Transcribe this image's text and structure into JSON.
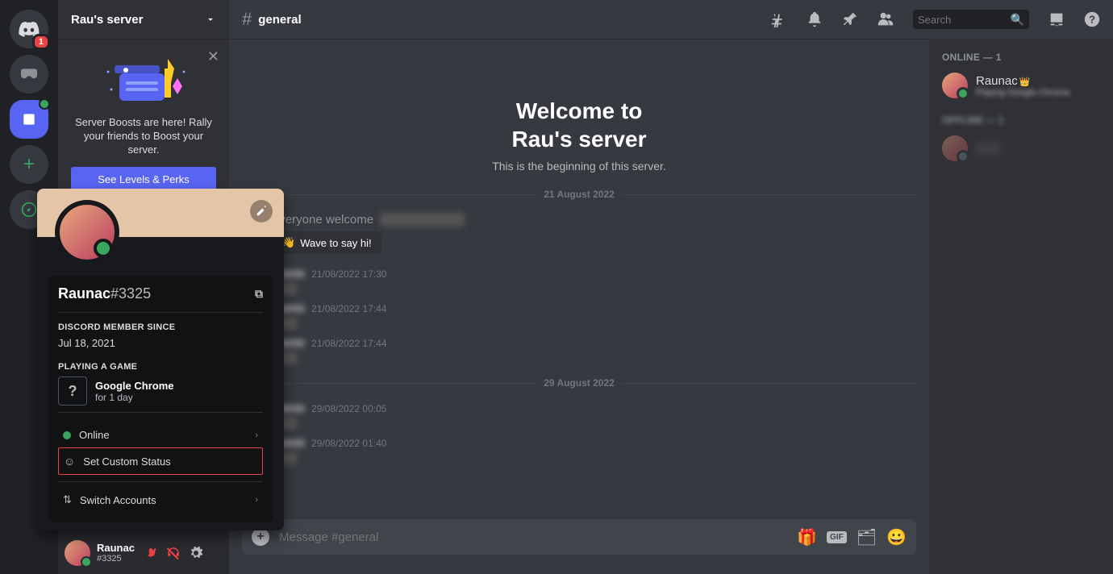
{
  "server_col": {
    "badge": "1"
  },
  "server_header": {
    "name": "Rau's server"
  },
  "boost": {
    "text": "Server Boosts are here! Rally your friends to Boost your server.",
    "button": "See Levels & Perks"
  },
  "user_panel": {
    "name": "Raunac",
    "tag": "#3325"
  },
  "channel_header": {
    "name": "general",
    "search_placeholder": "Search"
  },
  "welcome": {
    "line1": "Welcome to",
    "line2": "Rau's server",
    "sub": "This is the beginning of this server."
  },
  "dividers": {
    "d1": "21 August 2022",
    "d2": "29 August 2022"
  },
  "system": {
    "prefix": "everyone welcome",
    "wave": "Wave to say hi!"
  },
  "messages": [
    {
      "user": "Name",
      "time": "21/08/2022 17:30"
    },
    {
      "user": "Name",
      "time": "21/08/2022 17:44"
    },
    {
      "user": "Name",
      "time": "21/08/2022 17:44"
    },
    {
      "user": "Name",
      "time": "29/08/2022 00:05"
    },
    {
      "user": "Name",
      "time": "29/08/2022 01:40"
    }
  ],
  "chat_input": {
    "placeholder": "Message #general"
  },
  "members": {
    "online_header": "ONLINE — 1",
    "user": "Raunac",
    "activity": "Playing Google Chrome",
    "offline_header": "OFFLINE — 1",
    "offline_user": "User"
  },
  "popup": {
    "name": "Raunac",
    "discrim": "#3325",
    "since_label": "DISCORD MEMBER SINCE",
    "since_val": "Jul 18, 2021",
    "playing_label": "PLAYING A GAME",
    "game_name": "Google Chrome",
    "game_dur": "for 1 day",
    "online": "Online",
    "custom": "Set Custom Status",
    "switch": "Switch Accounts"
  }
}
